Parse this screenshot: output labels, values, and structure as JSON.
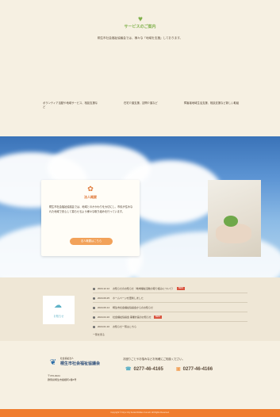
{
  "services": {
    "heading": "サービスのご案内",
    "subheading": "桐生市社会福祉協議会では、様々な「地域を支援」しております。",
    "items": [
      "ボランティア活動や地域サービス、相談支援など",
      "在宅介護支援、訪問介護など",
      "障害者地域生活支援、相談支援など新しい取組"
    ]
  },
  "hero": {
    "card": {
      "title": "法人概要",
      "text": "桐生市社会福祉協議会では、地域とのかかわりを大切にし、市民が住みなれた地域で安心して暮らせるよう様々な取り組みを行っています。",
      "button_label": "法人概要はこちら"
    }
  },
  "news": {
    "label": "お知らせ",
    "items": [
      {
        "date": "2024.12.12",
        "title": "お知らせのお知らせ（地域福祉活動の取り組みについて）",
        "tag": "NEW"
      },
      {
        "date": "2024.09.25",
        "title": "ホームページを更新しました",
        "tag": ""
      },
      {
        "date": "2024.06.14",
        "title": "桐生市社会福祉協議会からのお知らせ",
        "tag": ""
      },
      {
        "date": "2024.04.16",
        "title": "社会福祉協議会 事業計画のお知らせ",
        "tag": "NEW"
      },
      {
        "date": "2024.01.10",
        "title": "お知らせ一覧はこちら",
        "tag": ""
      }
    ],
    "more_label": "一覧を見る"
  },
  "footer": {
    "org_small": "社会福祉法人",
    "org_name": "桐生市社会福祉協議会",
    "address_line1": "〒376-0024",
    "address_line2": "群馬県桐生市織姫町2番5号",
    "contact_lead": "お困りごとやお悩みなどお気軽にご相談ください。",
    "phone1": "0277-46-4165",
    "phone2": "0277-46-4166",
    "copyright": "Copyright © Kiryu City Social Welfare Council. All Rights Reserved."
  },
  "colors": {
    "accent_green": "#7fb04a",
    "accent_orange": "#f2a25a",
    "news_blue": "#5fb2c7",
    "bar_orange": "#f07d2e",
    "tag_red": "#d9543f"
  }
}
